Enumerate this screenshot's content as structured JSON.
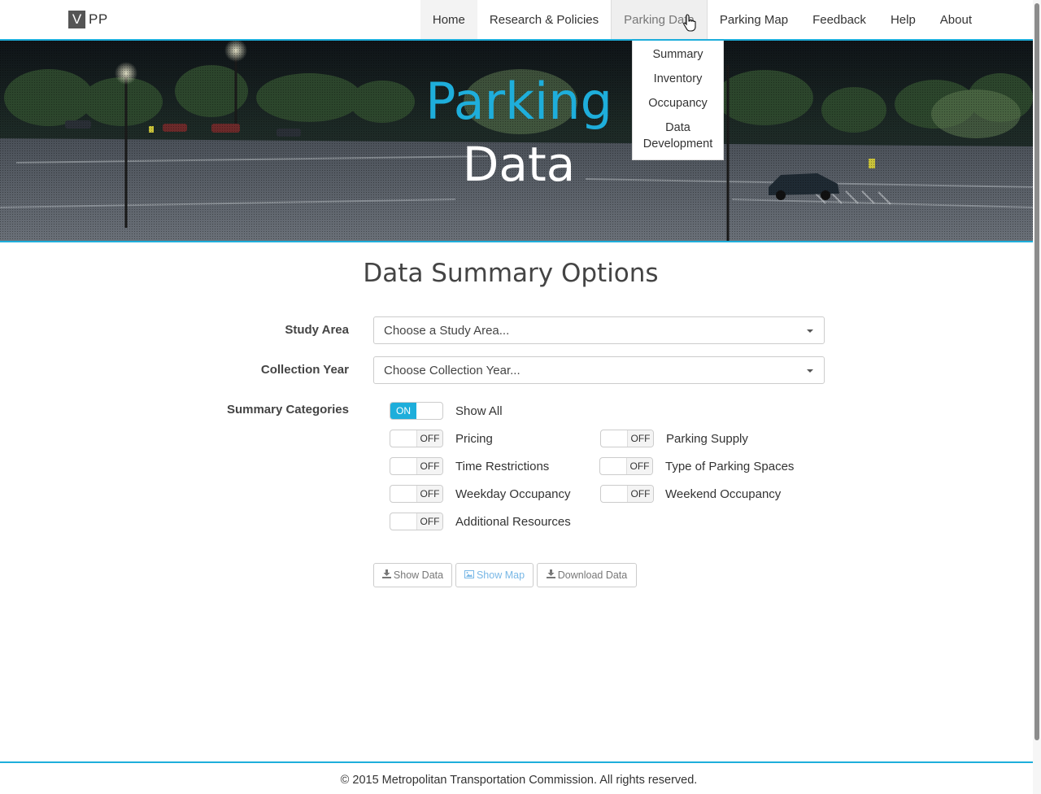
{
  "brand": {
    "box_letter": "V",
    "text": "PP"
  },
  "nav": {
    "items": [
      {
        "label": "Home"
      },
      {
        "label": "Research & Policies"
      },
      {
        "label": "Parking Data"
      },
      {
        "label": "Parking Map"
      },
      {
        "label": "Feedback"
      },
      {
        "label": "Help"
      },
      {
        "label": "About"
      }
    ],
    "dropdown": {
      "items": [
        {
          "label": "Summary"
        },
        {
          "label": "Inventory"
        },
        {
          "label": "Occupancy"
        },
        {
          "label": "Data Development"
        }
      ]
    }
  },
  "hero": {
    "title_line1": "Parking",
    "title_line2": "Data"
  },
  "main": {
    "title": "Data Summary Options",
    "study_area": {
      "label": "Study Area",
      "value": "Choose a Study Area..."
    },
    "collection_year": {
      "label": "Collection Year",
      "value": "Choose Collection Year..."
    },
    "summary_categories": {
      "label": "Summary Categories",
      "show_all": {
        "label": "Show All",
        "state": "ON"
      },
      "toggles": [
        {
          "label": "Pricing",
          "state": "OFF"
        },
        {
          "label": "Parking Supply",
          "state": "OFF"
        },
        {
          "label": "Time Restrictions",
          "state": "OFF"
        },
        {
          "label": "Type of Parking Spaces",
          "state": "OFF"
        },
        {
          "label": "Weekday Occupancy",
          "state": "OFF"
        },
        {
          "label": "Weekend Occupancy",
          "state": "OFF"
        },
        {
          "label": "Additional Resources",
          "state": "OFF"
        }
      ]
    },
    "buttons": {
      "show_data": "Show Data",
      "show_map": "Show Map",
      "download_data": "Download Data"
    }
  },
  "footer": {
    "text": "© 2015 Metropolitan Transportation Commission. All rights reserved."
  },
  "colors": {
    "accent": "#1eaedb",
    "text": "#333333"
  },
  "icons": [
    "download-icon",
    "image-icon",
    "chevron-down-icon",
    "hand-cursor-icon"
  ]
}
